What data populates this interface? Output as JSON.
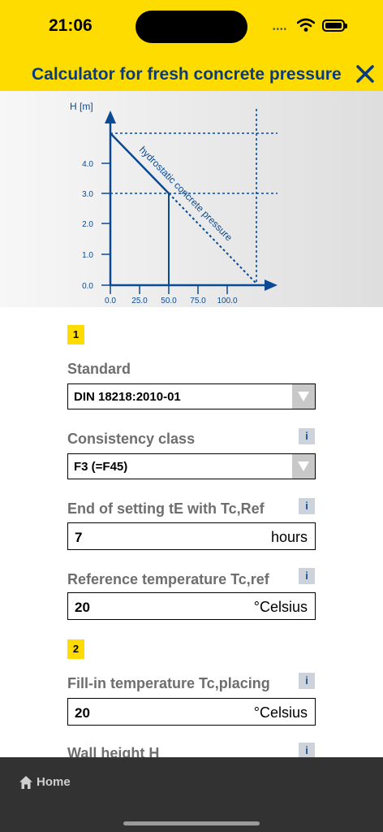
{
  "status_bar": {
    "time": "21:06",
    "signal_dots": "••••"
  },
  "header": {
    "title": "Calculator for fresh concrete pressure",
    "close_icon": "close-icon"
  },
  "diagram": {
    "y_axis_label": "H [m]",
    "y_ticks": [
      "4.0",
      "3.0",
      "2.0",
      "1.0",
      "0.0"
    ],
    "x_ticks": [
      "0.0",
      "25.0",
      "50.0",
      "75.0",
      "100.0"
    ],
    "line_label": "hydrostatic concrete pressure",
    "line_color": "#0a4a92"
  },
  "section1": {
    "badge": "1",
    "standard": {
      "label": "Standard",
      "value": "DIN 18218:2010-01"
    },
    "consistency": {
      "label": "Consistency class",
      "value": "F3 (=F45)",
      "info": "i"
    },
    "end_setting": {
      "label": "End of setting tE with Tc,Ref",
      "value": "7",
      "unit": "hours",
      "info": "i"
    },
    "ref_temp": {
      "label": "Reference temperature Tc,ref",
      "value": "20",
      "unit": "°Celsius",
      "info": "i"
    }
  },
  "section2": {
    "badge": "2",
    "fill_temp": {
      "label": "Fill-in temperature Tc,placing",
      "value": "20",
      "unit": "°Celsius",
      "info": "i"
    },
    "wall_height": {
      "label": "Wall height H",
      "info": "i"
    }
  },
  "bottom_bar": {
    "home_label": "Home",
    "home_icon": "home-icon"
  },
  "colors": {
    "accent": "#ffdc00",
    "brand_blue": "#0a3c7d",
    "bottom_bar": "#323232"
  }
}
